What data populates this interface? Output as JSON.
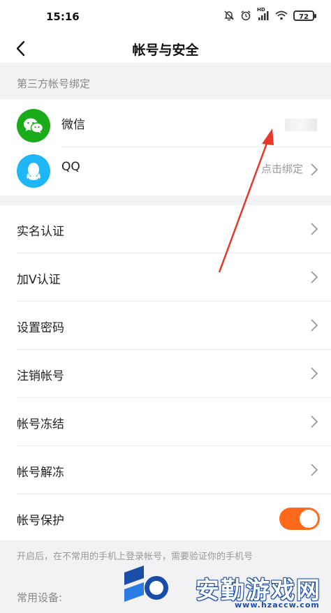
{
  "status_bar": {
    "time": "15:16",
    "network_label": "HD",
    "battery": "72",
    "icons": [
      "bell-off-icon",
      "alarm-icon",
      "signal-icon",
      "wifi-icon",
      "battery-icon"
    ]
  },
  "header": {
    "title": "帐号与安全",
    "back_icon": "chevron-left-icon"
  },
  "third_party": {
    "section_title": "第三方帐号绑定",
    "accounts": [
      {
        "label": "微信",
        "icon": "wechat-icon",
        "color": "#1aad19"
      },
      {
        "label": "QQ",
        "icon": "qq-icon",
        "color": "#1eb6f5",
        "hint": "点击绑定"
      }
    ]
  },
  "settings": {
    "items": [
      {
        "label": "实名认证"
      },
      {
        "label": "加V认证"
      },
      {
        "label": "设置密码"
      },
      {
        "label": "注销帐号"
      },
      {
        "label": "帐号冻结"
      },
      {
        "label": "帐号解冻"
      }
    ],
    "protection": {
      "label": "帐号保护",
      "enabled": true
    }
  },
  "footnote": "开启后，在不常用的手机上登录帐号，需要验证你的手机号",
  "devices_label": "常用设备:",
  "watermark": {
    "text": "安勤游戏网",
    "url": "www.hzaccw.com"
  },
  "colors": {
    "accent": "#ff6a1a",
    "arrow": "#e8382a",
    "wechat": "#1aad19",
    "qq": "#1eb6f5"
  }
}
